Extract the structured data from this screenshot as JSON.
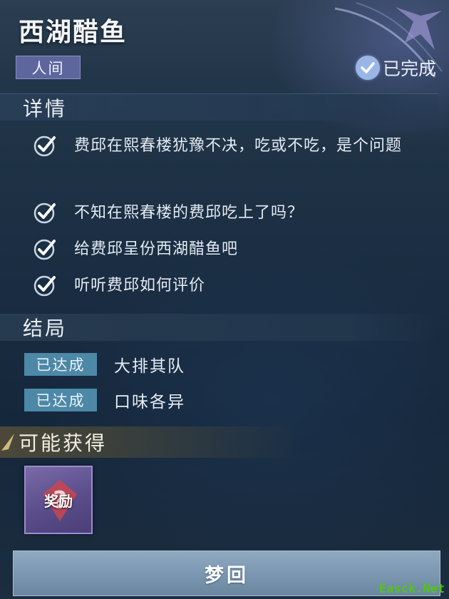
{
  "header": {
    "title": "西湖醋鱼",
    "realm_tag": "人间",
    "status_label": "已完成",
    "status_icon": "check-circle-icon"
  },
  "details": {
    "heading": "详情",
    "tasks": [
      {
        "text": "费邱在熙春楼犹豫不决，吃或不吃，是个问题",
        "done": true
      },
      {
        "text": "不知在熙春楼的费邱吃上了吗？",
        "done": true
      },
      {
        "text": "给费邱呈份西湖醋鱼吧",
        "done": true
      },
      {
        "text": "听听费邱如何评价",
        "done": true
      }
    ]
  },
  "endings": {
    "heading": "结局",
    "items": [
      {
        "badge": "已达成",
        "text": "大排其队"
      },
      {
        "badge": "已达成",
        "text": "口味各异"
      }
    ]
  },
  "rewards": {
    "heading": "可能获得",
    "card_label": "奖励",
    "card_icon": "question-mark-icon"
  },
  "actions": {
    "dream_button": "梦回"
  },
  "watermark": "Easck.Net",
  "colors": {
    "realm_tag": "#5e669e",
    "ending_badge": "#4d88a6",
    "reward_card": "#5a4d8a",
    "button": "#7a96b0",
    "watermark": "#52c41a"
  }
}
